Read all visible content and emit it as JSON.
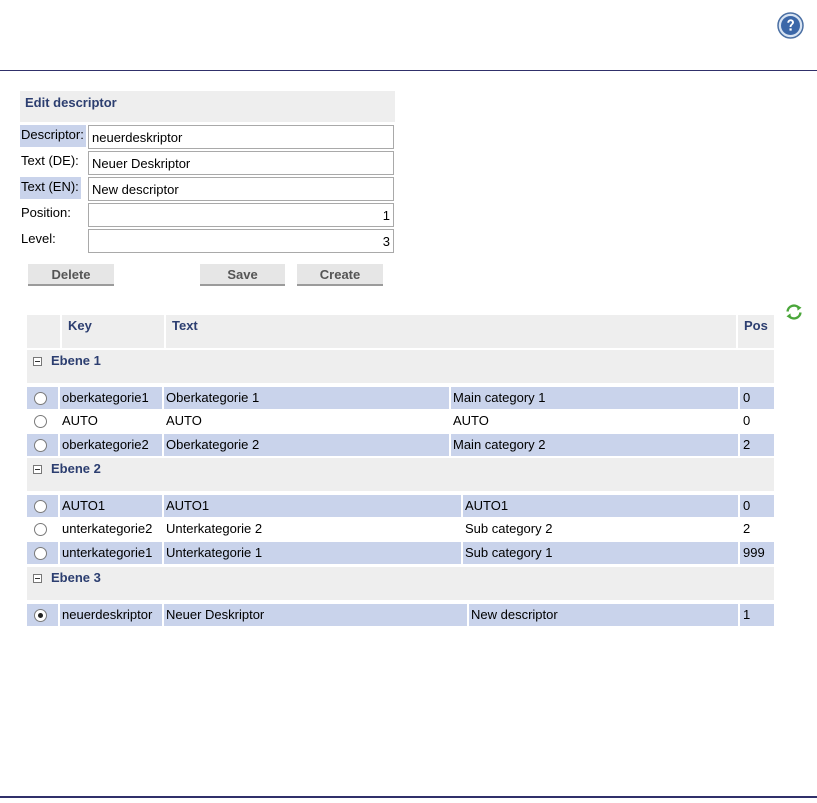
{
  "form": {
    "title": "Edit descriptor",
    "fields": [
      {
        "label": "Descriptor:",
        "value": "neuerdeskriptor"
      },
      {
        "label": "Text (DE):",
        "value": "Neuer Deskriptor"
      },
      {
        "label": "Text (EN):",
        "value": "New descriptor"
      },
      {
        "label": "Position:",
        "value": "1"
      },
      {
        "label": "Level:",
        "value": "3"
      }
    ],
    "buttons": {
      "delete": "Delete",
      "save": "Save",
      "create": "Create"
    }
  },
  "table": {
    "headers": {
      "key": "Key",
      "text": "Text",
      "pos": "Pos"
    },
    "groups": [
      {
        "name": "Ebene 1",
        "rows": [
          {
            "key": "oberkategorie1",
            "de": "Oberkategorie 1",
            "en": "Main category 1",
            "pos": "0",
            "selected": false
          },
          {
            "key": "AUTO",
            "de": "AUTO",
            "en": "AUTO",
            "pos": "0",
            "selected": false
          },
          {
            "key": "oberkategorie2",
            "de": "Oberkategorie 2",
            "en": "Main category 2",
            "pos": "2",
            "selected": false
          }
        ]
      },
      {
        "name": "Ebene 2",
        "rows": [
          {
            "key": "AUTO1",
            "de": "AUTO1",
            "en": "AUTO1",
            "pos": "0",
            "selected": false
          },
          {
            "key": "unterkategorie2",
            "de": "Unterkategorie 2",
            "en": "Sub category 2",
            "pos": "2",
            "selected": false
          },
          {
            "key": "unterkategorie1",
            "de": "Unterkategorie 1",
            "en": "Sub category 1",
            "pos": "999",
            "selected": false
          }
        ]
      },
      {
        "name": "Ebene 3",
        "rows": [
          {
            "key": "neuerdeskriptor",
            "de": "Neuer Deskriptor",
            "en": "New descriptor",
            "pos": "1",
            "selected": true
          }
        ]
      }
    ]
  },
  "icons": {
    "help": "help-icon",
    "refresh": "refresh-icon"
  },
  "colors": {
    "accent": "#2c3e70",
    "row_highlight": "#c9d3eb",
    "panel": "#eeeeee"
  }
}
